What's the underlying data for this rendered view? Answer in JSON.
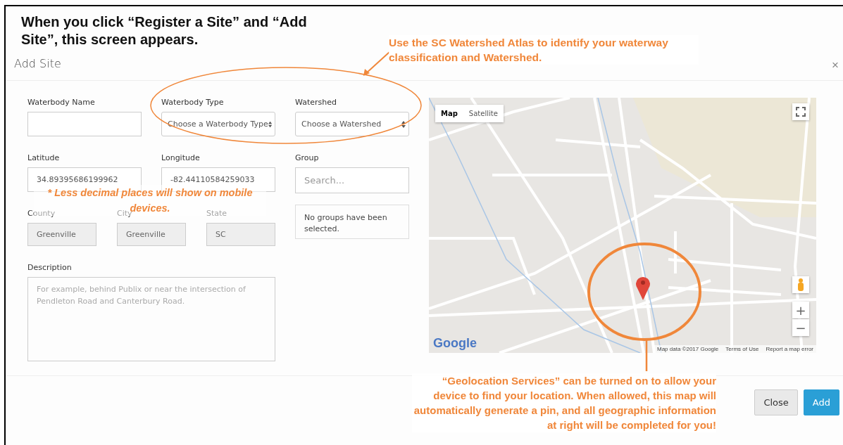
{
  "heading": "When you click “Register a Site” and “Add Site”, this screen appears.",
  "dialog": {
    "title": "Add Site",
    "close": "×",
    "fields": [
      {
        "label": "Waterbody Name",
        "kind": "text",
        "disabled": false
      },
      {
        "label": "Waterbody Type",
        "kind": "select",
        "placeholder": "Choose a Waterbody Type",
        "disabled": false
      },
      {
        "label": "Watershed",
        "kind": "select",
        "placeholder": "Choose a Watershed",
        "disabled": false
      },
      {
        "label": "Latitude",
        "kind": "text",
        "value": "34.89395686199962",
        "disabled": false
      },
      {
        "label": "Longitude",
        "kind": "text",
        "value": "-82.44110584259033",
        "disabled": false
      },
      {
        "label": "Group",
        "kind": "group",
        "placeholder": "Search...",
        "note": "No groups have been selected.",
        "disabled": false
      },
      {
        "label": "County",
        "kind": "text",
        "value": "Greenville",
        "disabled": true
      },
      {
        "label": "City",
        "kind": "text",
        "value": "Greenville",
        "disabled": true
      },
      {
        "label": "State",
        "kind": "text",
        "value": "SC",
        "disabled": true
      },
      {
        "label": "Description",
        "kind": "textarea",
        "placeholder": "For example, behind Publix or near the intersection of Pendleton Road and Canterbury Road.",
        "disabled": false
      }
    ],
    "map": {
      "types": [
        {
          "label": "Map",
          "selected": true
        },
        {
          "label": "Satellite",
          "selected": false
        }
      ],
      "zoom_in": "+",
      "zoom_out": "−",
      "logo": "Google",
      "attribution": [
        "Map data ©2017 Google",
        "Terms of Use",
        "Report a map error"
      ]
    },
    "buttons": [
      {
        "label": "Close",
        "kind": "default"
      },
      {
        "label": "Add",
        "kind": "primary"
      }
    ]
  },
  "annotations": [
    {
      "text": "Use the SC Watershed Atlas to identify your waterway classification and Watershed."
    },
    {
      "text": "* Less decimal places will show on mobile devices."
    },
    {
      "text": "“Geolocation Services” can be turned on to allow your device to find your location. When allowed, this map will automatically generate a pin, and all geographic information at right will be completed for you!"
    }
  ]
}
